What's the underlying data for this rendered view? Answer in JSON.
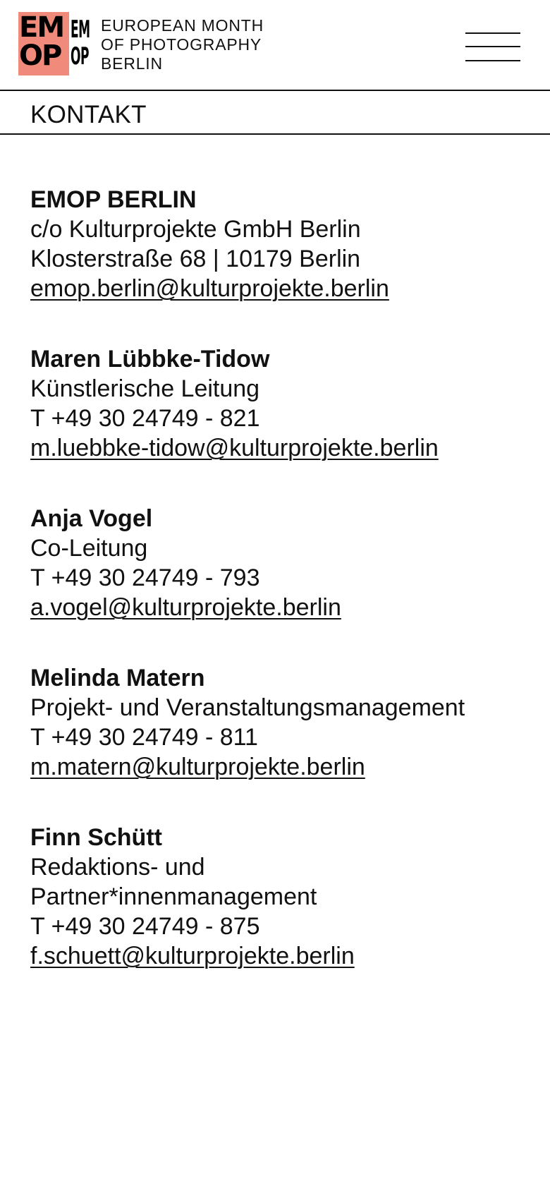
{
  "header": {
    "logo_letters_1": "EM",
    "logo_letters_2": "OP",
    "logo_narrow_1": "EM",
    "logo_narrow_2": "OP",
    "logo_line_1": "EUROPEAN MONTH",
    "logo_line_2": "OF PHOTOGRAPHY",
    "logo_line_3": "BERLIN",
    "logo_color": "#f08a7a",
    "menu_icon": "hamburger-menu-icon"
  },
  "page": {
    "title": "KONTAKT"
  },
  "contacts": [
    {
      "name": "EMOP BERLIN",
      "line1": "c/o Kulturprojekte GmbH Berlin",
      "line2": "Klosterstraße 68 | 10179 Berlin",
      "email": "emop.berlin@kulturprojekte.berlin"
    },
    {
      "name": "Maren Lübbke-Tidow",
      "role": "Künstlerische Leitung",
      "phone": "T +49 30 24749 - 821",
      "email": "m.luebbke-tidow@kulturprojekte.berlin"
    },
    {
      "name": "Anja Vogel",
      "role": "Co-Leitung",
      "phone": "T +49 30 24749 - 793",
      "email": "a.vogel@kulturprojekte.berlin"
    },
    {
      "name": "Melinda Matern",
      "role": "Projekt- und Veranstaltungsmanagement",
      "phone": "T +49 30 24749 - 811",
      "email": "m.matern@kulturprojekte.berlin"
    },
    {
      "name": "Finn Schütt",
      "role_line1": "Redaktions- und",
      "role_line2": "Partner*innenmanagement",
      "phone": "T +49 30 24749 - 875",
      "email": "f.schuett@kulturprojekte.berlin"
    }
  ]
}
